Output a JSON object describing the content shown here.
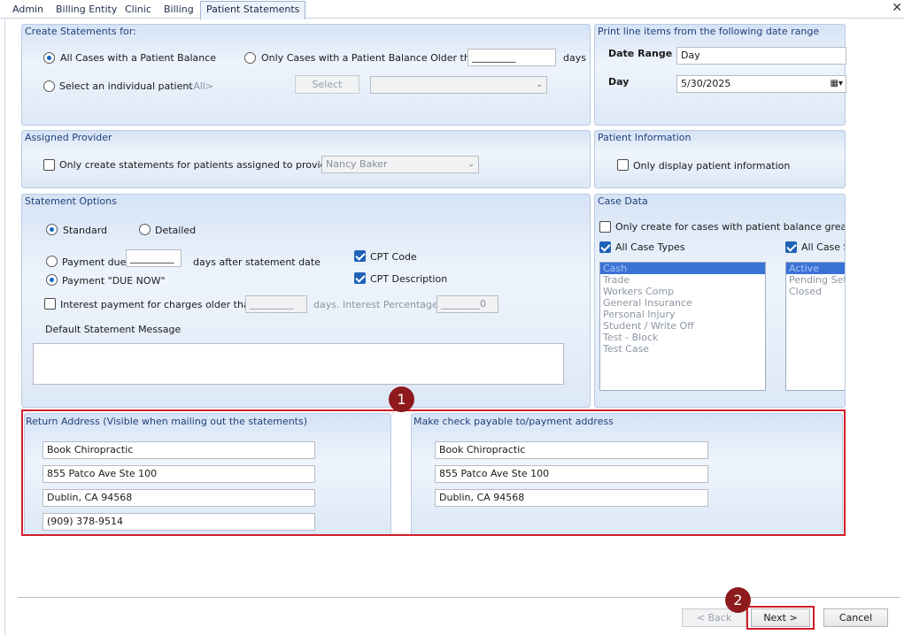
{
  "tabs": [
    "Admin",
    "Billing Entity",
    "Clinic",
    "Billing",
    "Patient Statements"
  ],
  "create_statements": {
    "title": "Create Statements for:",
    "all_cases_label": "All Cases with a Patient Balance",
    "older_than_label": "Only Cases with a Patient Balance Older than;",
    "days_value": "_________",
    "days_label": "days",
    "individual_label": "Select an individual patient",
    "individual_value": "<All>",
    "select_button": "Select"
  },
  "date_range": {
    "title": "Print line items from the following date range",
    "date_range_label": "Date Range",
    "date_range_value": "Day",
    "day_label": "Day",
    "day_value": "5/30/2025"
  },
  "assigned_provider": {
    "title": "Assigned Provider",
    "checkbox_label": "Only create statements for patients assigned to provider:",
    "provider_value": "Nancy Baker"
  },
  "patient_information": {
    "title": "Patient Information",
    "checkbox_label": "Only display patient information"
  },
  "statement_options": {
    "title": "Statement Options",
    "standard_label": "Standard",
    "detailed_label": "Detailed",
    "payment_due_label": "Payment due",
    "payment_due_value": "_________",
    "days_after_label": "days after statement date",
    "payment_now_label": "Payment \"DUE NOW\"",
    "cpt_code_label": "CPT Code",
    "cpt_desc_label": "CPT Description",
    "interest_label": "Interest payment for charges older than:",
    "interest_days_value": "_________",
    "days_label": "days.",
    "interest_pct_label": "Interest Percentage:",
    "interest_pct_value": "________0",
    "default_message_label": "Default Statement Message"
  },
  "case_data": {
    "title": "Case Data",
    "balance_label": "Only create for cases with patient balance greater tha",
    "all_case_types_label": "All Case Types",
    "all_case_status_label": "All Case St",
    "case_types": [
      "Cash",
      "Trade",
      "Workers Comp",
      "General Insurance",
      "Personal Injury",
      "Student / Write Off",
      "Test - Block",
      "Test Case"
    ],
    "case_status": [
      "Active",
      "Pending Settle",
      "Closed"
    ]
  },
  "return_address": {
    "title": "Return Address (Visible when mailing out the statements)",
    "line1": "Book Chiropractic",
    "line2": "855 Patco Ave Ste 100",
    "line3": "Dublin, CA 94568",
    "phone": "(909) 378-9514"
  },
  "payment_address": {
    "title": "Make check payable to/payment address",
    "line1": "Book Chiropractic",
    "line2": "855 Patco Ave Ste 100",
    "line3": "Dublin, CA 94568"
  },
  "markers": {
    "one": "1",
    "two": "2"
  },
  "footer": {
    "back_label": "< Back",
    "next_label": "Next >",
    "cancel_label": "Cancel"
  }
}
